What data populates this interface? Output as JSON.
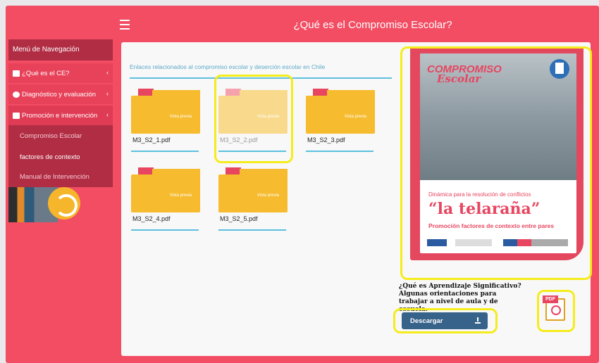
{
  "header": {
    "title": "¿Qué es el Compromiso Escolar?"
  },
  "sidebar": {
    "menu_title": "Menú de Navegación",
    "items": [
      {
        "label": "¿Qué es el CE?",
        "chevron": "‹"
      },
      {
        "label": "Diagnóstico y evaluación",
        "chevron": "‹"
      },
      {
        "label": "Promoción e intervención",
        "chevron": "‹"
      }
    ],
    "submenu": [
      {
        "label": "Compromiso Escolar"
      },
      {
        "label": "factores de contexto"
      },
      {
        "label": "Manual de Intervención"
      }
    ]
  },
  "main": {
    "links_title": "Enlaces relacionados al compromiso escolar y deserción escolar en Chile",
    "preview_label": "Vista previa",
    "files": [
      {
        "name": "M3_S2_1.pdf"
      },
      {
        "name": "M3_S2_2.pdf"
      },
      {
        "name": "M3_S2_3.pdf"
      },
      {
        "name": "M3_S2_4.pdf"
      },
      {
        "name": "M3_S2_5.pdf"
      }
    ]
  },
  "poster": {
    "logo_top": "COMPROMISO",
    "logo_bottom": "Escolar",
    "subtitle": "Dinámica para la resolución de conflictos",
    "big_title": "“la telaraña”",
    "tagline": "Promoción factores de contexto entre pares"
  },
  "download": {
    "description": "¿Qué es Aprendizaje Significativo? Algunas orientaciones para trabajar a nivel de aula y de escuela.",
    "button_label": "Descargar"
  },
  "colors": {
    "brand": "#f24d63",
    "sidebar_dark": "#b02d44",
    "folder": "#f6bb2e",
    "accent_line": "#5bc0de",
    "highlight": "#f5ec1c",
    "button": "#37628a"
  },
  "icons": [
    "hamburger-icon",
    "folder-icon",
    "eye-icon",
    "download-icon",
    "pdf-icon",
    "refresh-icon"
  ]
}
